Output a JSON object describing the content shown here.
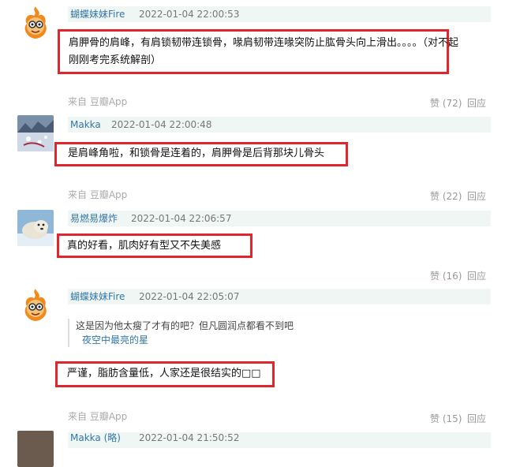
{
  "comments": [
    {
      "author": "蝴蝶妹妹Fire",
      "time": "2022-01-04 22:00:53",
      "text_line1": "肩胛骨的肩峰，有肩锁韧带连锁骨，喙肩韧带连喙突防止肱骨头向上滑出。。。。（对不起",
      "text_line2": "刚刚考完系统解剖）",
      "source_prefix": "来自",
      "source_app": "豆瓣App",
      "like": "赞 (72)",
      "reply": "回应"
    },
    {
      "author": "Makka",
      "time": "2022-01-04 22:00:48",
      "text": "是肩峰角啦，和锁骨是连着的，肩胛骨是后背那块儿骨头",
      "source_prefix": "来自",
      "source_app": "豆瓣App",
      "like": "赞 (22)",
      "reply": "回应"
    },
    {
      "author": "易燃易爆炸",
      "time": "2022-01-04 22:06:57",
      "text": "真的好看，肌肉好有型又不失美感",
      "like": "赞 (16)",
      "reply": "回应"
    },
    {
      "author": "蝴蝶妹妹Fire",
      "time": "2022-01-04 22:05:07",
      "quote_text": "这是因为他太瘦了才有的吧？但凡圆润点都看不到吧",
      "quote_author": "夜空中最亮的星",
      "text": "严谨，脂肪含量低，人家还是很结实的□□",
      "source_prefix": "来自",
      "source_app": "豆瓣App",
      "like": "赞 (15)",
      "reply": "回应"
    },
    {
      "author": "Makka (略)",
      "time": "2022-01-04 21:50:52"
    }
  ],
  "colors": {
    "highlight": "#e0262c",
    "author_link": "#3377aa",
    "header_bg": "#f0f6f3"
  },
  "icons": [
    "cartoon-avatar",
    "winter-landscape-avatar",
    "seal-avatar"
  ]
}
